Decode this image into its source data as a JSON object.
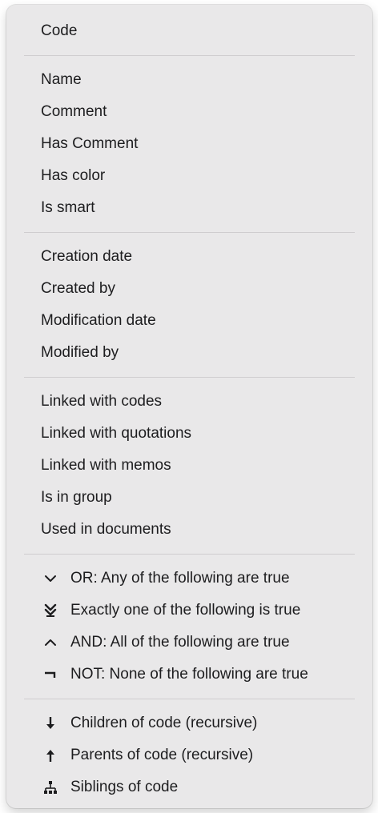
{
  "menu": {
    "top": {
      "code": "Code"
    },
    "properties": {
      "name": "Name",
      "comment": "Comment",
      "has_comment": "Has Comment",
      "has_color": "Has color",
      "is_smart": "Is smart"
    },
    "metadata": {
      "creation_date": "Creation date",
      "created_by": "Created by",
      "modification_date": "Modification date",
      "modified_by": "Modified by"
    },
    "links": {
      "linked_with_codes": "Linked with codes",
      "linked_with_quotations": "Linked with quotations",
      "linked_with_memos": "Linked with memos",
      "is_in_group": "Is in group",
      "used_in_documents": "Used in documents"
    },
    "logic": {
      "or": {
        "label": "OR: Any of the following are true",
        "icon": "chevron-down-icon"
      },
      "xor": {
        "label": "Exactly one of the following is true",
        "icon": "exactly-one-icon"
      },
      "and": {
        "label": "AND: All of the following are true",
        "icon": "chevron-up-icon"
      },
      "not": {
        "label": "NOT: None of the following are true",
        "icon": "not-icon"
      }
    },
    "hierarchy": {
      "children": {
        "label": "Children of code (recursive)",
        "icon": "arrow-down-icon"
      },
      "parents": {
        "label": "Parents of code (recursive)",
        "icon": "arrow-up-icon"
      },
      "siblings": {
        "label": "Siblings of code",
        "icon": "hierarchy-icon"
      }
    }
  }
}
